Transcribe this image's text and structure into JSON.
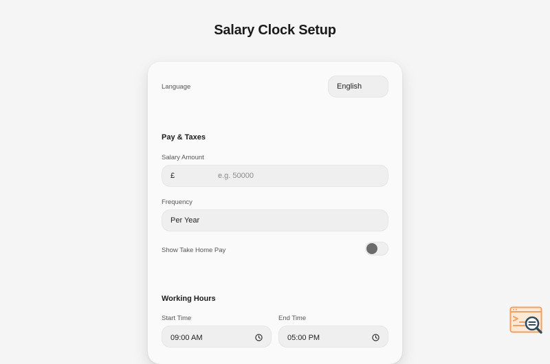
{
  "page": {
    "title": "Salary Clock Setup"
  },
  "language": {
    "label": "Language",
    "selected": "English"
  },
  "pay_taxes": {
    "heading": "Pay & Taxes",
    "salary_label": "Salary Amount",
    "currency_symbol": "£",
    "salary_value": "",
    "salary_placeholder": "e.g. 50000",
    "frequency_label": "Frequency",
    "frequency_selected": "Per Year",
    "take_home_label": "Show Take Home Pay",
    "take_home_enabled": false
  },
  "working_hours": {
    "heading": "Working Hours",
    "start_label": "Start Time",
    "start_value": "09:00 AM",
    "end_label": "End Time",
    "end_value": "05:00 PM"
  },
  "icons": {
    "time_picker": "clock-icon",
    "floating_button": "browser-search-icon"
  },
  "colors": {
    "background": "#f5f5f6",
    "card": "#fafafa",
    "field": "#efefef",
    "toggle_knob": "#6b6b6b",
    "fab_orange": "#f0a060",
    "fab_dark": "#2f4a5a"
  }
}
